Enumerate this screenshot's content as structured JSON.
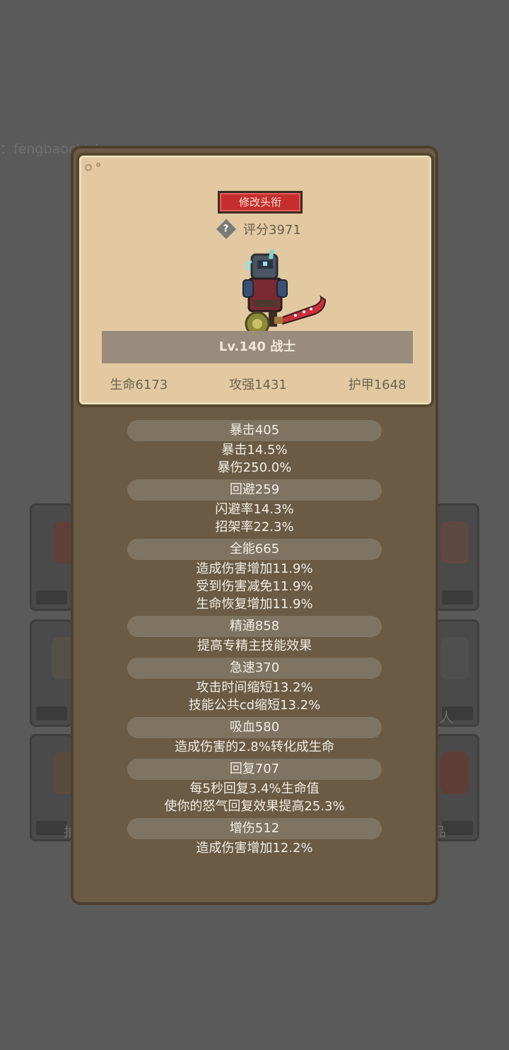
{
  "background": {
    "partial_text": "：fengbaochizhu",
    "tile_labels": [
      "人",
      "拍",
      "品"
    ]
  },
  "card": {
    "title_button": "修改头衔",
    "help_icon": "?",
    "score": "评分3971",
    "level_class": "Lv.140 战士",
    "stats": [
      "生命6173",
      "攻强1431",
      "护甲1648"
    ]
  },
  "attributes": [
    {
      "title": "暴击405",
      "lines": [
        "暴击14.5%",
        "暴伤250.0%"
      ]
    },
    {
      "title": "回避259",
      "lines": [
        "闪避率14.3%",
        "招架率22.3%"
      ]
    },
    {
      "title": "全能665",
      "lines": [
        "造成伤害增加11.9%",
        "受到伤害减免11.9%",
        "生命恢复增加11.9%"
      ]
    },
    {
      "title": "精通858",
      "lines": [
        "提高专精主技能效果"
      ]
    },
    {
      "title": "急速370",
      "lines": [
        "攻击时间缩短13.2%",
        "技能公共cd缩短13.2%"
      ]
    },
    {
      "title": "吸血580",
      "lines": [
        "造成伤害的2.8%转化成生命"
      ]
    },
    {
      "title": "回复707",
      "lines": [
        "每5秒回复3.4%生命值",
        "使你的怒气回复效果提高25.3%"
      ]
    },
    {
      "title": "增伤512",
      "lines": [
        "造成伤害增加12.2%"
      ]
    }
  ],
  "colors": {
    "card_bg": "#e2c9a2",
    "panel_bg": "#6b5b45",
    "title_button": "#c62e2e",
    "pill": "#7f7462"
  }
}
